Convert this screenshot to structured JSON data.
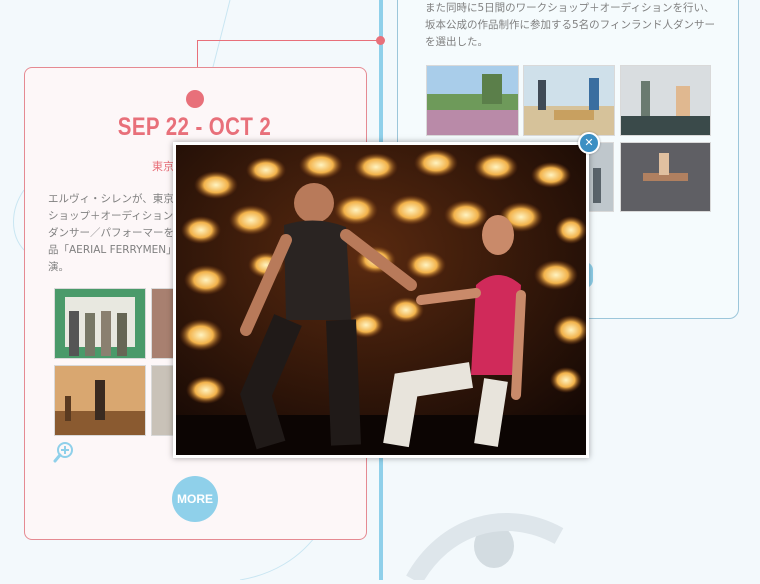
{
  "left_event": {
    "date": "SEP 22 - OCT 2",
    "location": "東京",
    "text_lines": [
      "エルヴィ・シレンが、東京",
      "ショップ＋オーディション",
      "ダンサー／パフォーマーを",
      "品「AERIAL FERRYMEN」",
      "演。"
    ],
    "more_label": "MORE",
    "zoom_icon": "zoom-in-icon"
  },
  "right_event": {
    "text_lines": [
      "また同時に5日間のワークショップ＋オーディションを行い、",
      "坂本公成の作品制作に参加する5名のフィンランド人ダンサー",
      "を選出した。"
    ]
  },
  "lightbox": {
    "close_icon": "close-icon",
    "close_glyph": "✕"
  },
  "colors": {
    "accent_pink": "#e8707a",
    "accent_blue": "#8fd0ea",
    "timeline": "#8fd0ea"
  }
}
